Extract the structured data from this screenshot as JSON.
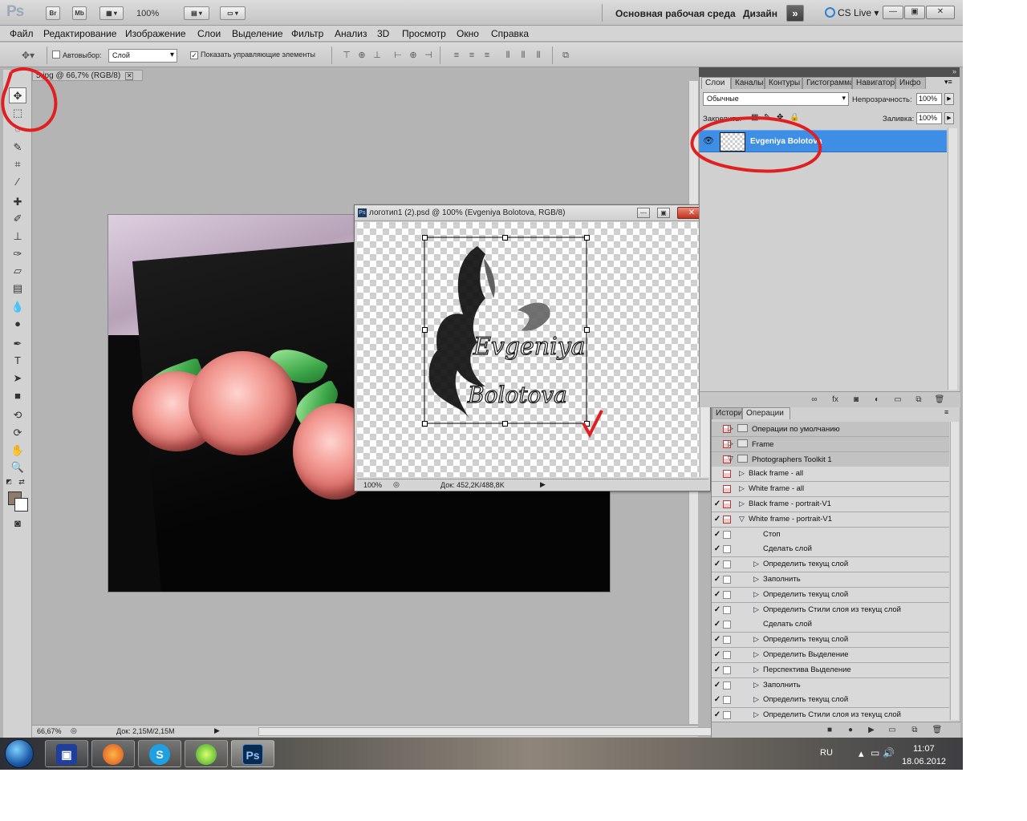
{
  "appbar": {
    "logo": "Ps",
    "bridge": "Br",
    "minibridge": "Mb",
    "zoom": "100%",
    "workspace": "Основная рабочая среда",
    "design": "Дизайн",
    "cslive": "CS Live"
  },
  "menu": [
    "Файл",
    "Редактирование",
    "Изображение",
    "Слои",
    "Выделение",
    "Фильтр",
    "Анализ",
    "3D",
    "Просмотр",
    "Окно",
    "Справка"
  ],
  "options": {
    "autoselect": "Автовыбор:",
    "autoselect_value": "Слой",
    "show_controls": "Показать управляющие элементы"
  },
  "document": {
    "tab_title": "5.jpg @ 66,7% (RGB/8)",
    "zoom": "66,67%",
    "doc_info": "Док: 2,15M/2,15M"
  },
  "logo_window": {
    "title": "логотип1 (2).psd @ 100% (Evgeniya Bolotova, RGB/8)",
    "zoom": "100%",
    "doc_info": "Док: 452,2K/488,8K",
    "logo_line1": "Evgeniya",
    "logo_line2": "Bolotova"
  },
  "layers": {
    "tabs": [
      "Слои",
      "Каналы",
      "Контуры",
      "Гистограмма",
      "Навигатор",
      "Инфо"
    ],
    "blend_mode": "Обычные",
    "opacity_label": "Непрозрачность:",
    "opacity": "100%",
    "lock_label": "Закрепить:",
    "fill_label": "Заливка:",
    "fill": "100%",
    "layer_name": "Evgeniya Bolotova"
  },
  "actions": {
    "tabs": [
      "История",
      "Операции"
    ],
    "rows": [
      {
        "label": "Операции по умолчанию",
        "indent": 1,
        "check": false,
        "folder": true
      },
      {
        "label": "Frame",
        "indent": 1,
        "check": false,
        "folder": true
      },
      {
        "label": "Photographers Toolkit 1",
        "indent": 1,
        "check": false,
        "folder": true
      },
      {
        "label": "Black frame - all",
        "indent": 2,
        "check": false
      },
      {
        "label": "White frame - all",
        "indent": 2,
        "check": false
      },
      {
        "label": "Black frame - portrait-V1",
        "indent": 2,
        "check": true
      },
      {
        "label": "White frame - portrait-V1",
        "indent": 2,
        "check": true
      },
      {
        "label": "Стоп",
        "indent": 3,
        "check": true
      },
      {
        "label": "Сделать слой",
        "indent": 3,
        "check": true
      },
      {
        "label": "Определить текущ слой",
        "indent": 3,
        "check": true
      },
      {
        "label": "Заполнить",
        "indent": 3,
        "check": true
      },
      {
        "label": "Определить текущ слой",
        "indent": 3,
        "check": true
      },
      {
        "label": "Определить Стили слоя из текущ слой",
        "indent": 3,
        "check": true
      },
      {
        "label": "Сделать слой",
        "indent": 3,
        "check": true
      },
      {
        "label": "Определить текущ слой",
        "indent": 3,
        "check": true
      },
      {
        "label": "Определить Выделение",
        "indent": 3,
        "check": true
      },
      {
        "label": "Перспектива Выделение",
        "indent": 3,
        "check": true
      },
      {
        "label": "Заполнить",
        "indent": 3,
        "check": true
      },
      {
        "label": "Определить текущ слой",
        "indent": 3,
        "check": true
      },
      {
        "label": "Определить Стили слоя из текущ слой",
        "indent": 3,
        "check": true
      }
    ]
  },
  "taskbar": {
    "lang": "RU",
    "time": "11:07",
    "date": "18.06.2012"
  },
  "colors": {
    "accent": "#3d8ee4",
    "annotation": "#e02020",
    "foreground": "#8e7b6c",
    "background": "#ffffff"
  }
}
